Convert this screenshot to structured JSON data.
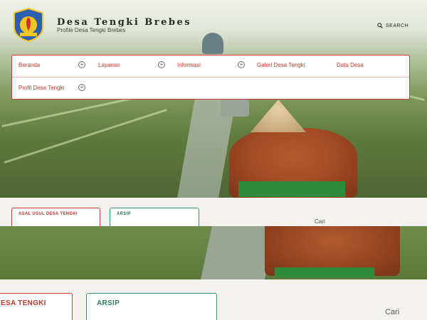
{
  "header": {
    "site_title": "Desa Tengki Brebes",
    "tagline": "Profile Desa Tengki Brebes",
    "search_label": "SEARCH"
  },
  "nav": {
    "items": [
      {
        "label": "Beranda",
        "has_submenu": true
      },
      {
        "label": "Layanan",
        "has_submenu": true
      },
      {
        "label": "Informasi",
        "has_submenu": true
      },
      {
        "label": "Galeri Desa Tengki",
        "has_submenu": false
      },
      {
        "label": "Data Desa",
        "has_submenu": false
      },
      {
        "label": "Profil Desa Tengki",
        "has_submenu": true
      }
    ]
  },
  "widgets": {
    "asal_usul": "ASAL USUL DESA TENGKI",
    "arsip": "ARSIP",
    "asal_usul_zoomed": "ESA TENGKI",
    "arsip_zoomed": "ARSIP",
    "cari": "Cari",
    "cari_zoomed": "Cari"
  },
  "colors": {
    "nav_border": "#d23a3a",
    "nav_text": "#c0392b",
    "arsip_border": "#3f9a6a",
    "arsip_text": "#2f7d57"
  }
}
